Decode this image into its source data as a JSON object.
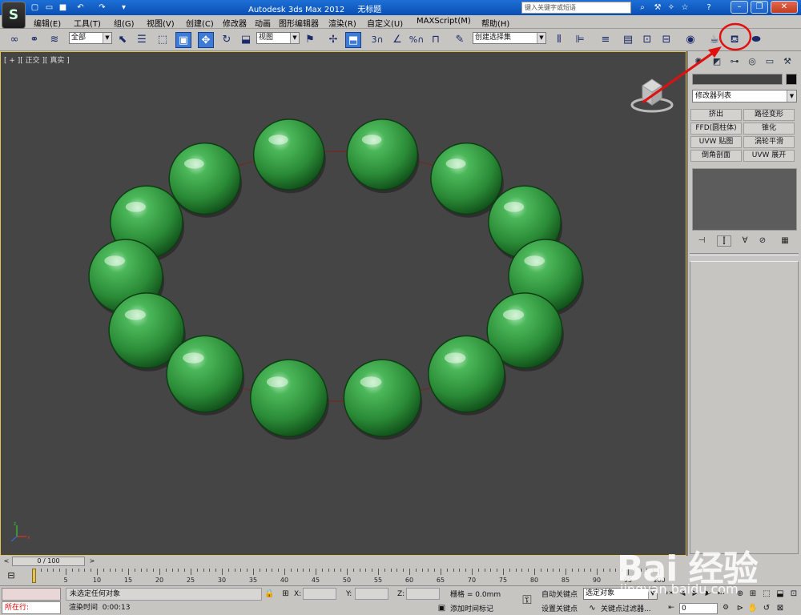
{
  "titlebar": {
    "app_title": "Autodesk 3ds Max  2012",
    "doc_title": "无标题",
    "search_placeholder": "键入关键字或短语",
    "help_icon": "?"
  },
  "menu": [
    "编辑(E)",
    "工具(T)",
    "组(G)",
    "视图(V)",
    "创建(C)",
    "修改器",
    "动画",
    "图形编辑器",
    "渲染(R)",
    "自定义(U)",
    "MAXScript(M)",
    "帮助(H)"
  ],
  "toolbar": {
    "selection_filter": "全部",
    "ref_coord": "视图",
    "named_selection": "创建选择集",
    "snap_label": "3",
    "percent_label": "%"
  },
  "viewport": {
    "label": "[ + ][ 正交 ][ 真实 ]",
    "bead_count": 14,
    "bead_color": "#2e8a3a",
    "border_color": "#e0c35a",
    "background_color": "#454545"
  },
  "command_panel": {
    "modifier_list": "修改器列表",
    "buttons": [
      "挤出",
      "路径变形",
      "FFD(圆柱体)",
      "锥化",
      "UVW 贴图",
      "涡轮平滑",
      "倒角剖面",
      "UVW 展开"
    ]
  },
  "timeline": {
    "position": "0 / 100",
    "ticks": [
      "5",
      "10",
      "15",
      "20",
      "25",
      "30",
      "35",
      "40",
      "45",
      "50",
      "55",
      "60",
      "65",
      "70",
      "75",
      "80",
      "85",
      "90",
      "95",
      "100"
    ]
  },
  "status": {
    "maxscript_label": "所在行:",
    "prompt": "未选定任何对象",
    "render_time_label": "渲染时间",
    "render_time": "0:00:13",
    "x_label": "X:",
    "y_label": "Y:",
    "z_label": "Z:",
    "grid_label": "栅格 = 0.0mm",
    "add_time_tag": "添加时间标记",
    "auto_key": "自动关键点",
    "set_key": "设置关键点",
    "selection_dropdown": "选定对象",
    "key_filters": "关键点过滤器...",
    "frame_value": "0"
  },
  "watermark": {
    "logo": "Bai 经验",
    "url": "jingyan.baidu.com"
  },
  "annotation": {
    "color": "#e01010"
  }
}
